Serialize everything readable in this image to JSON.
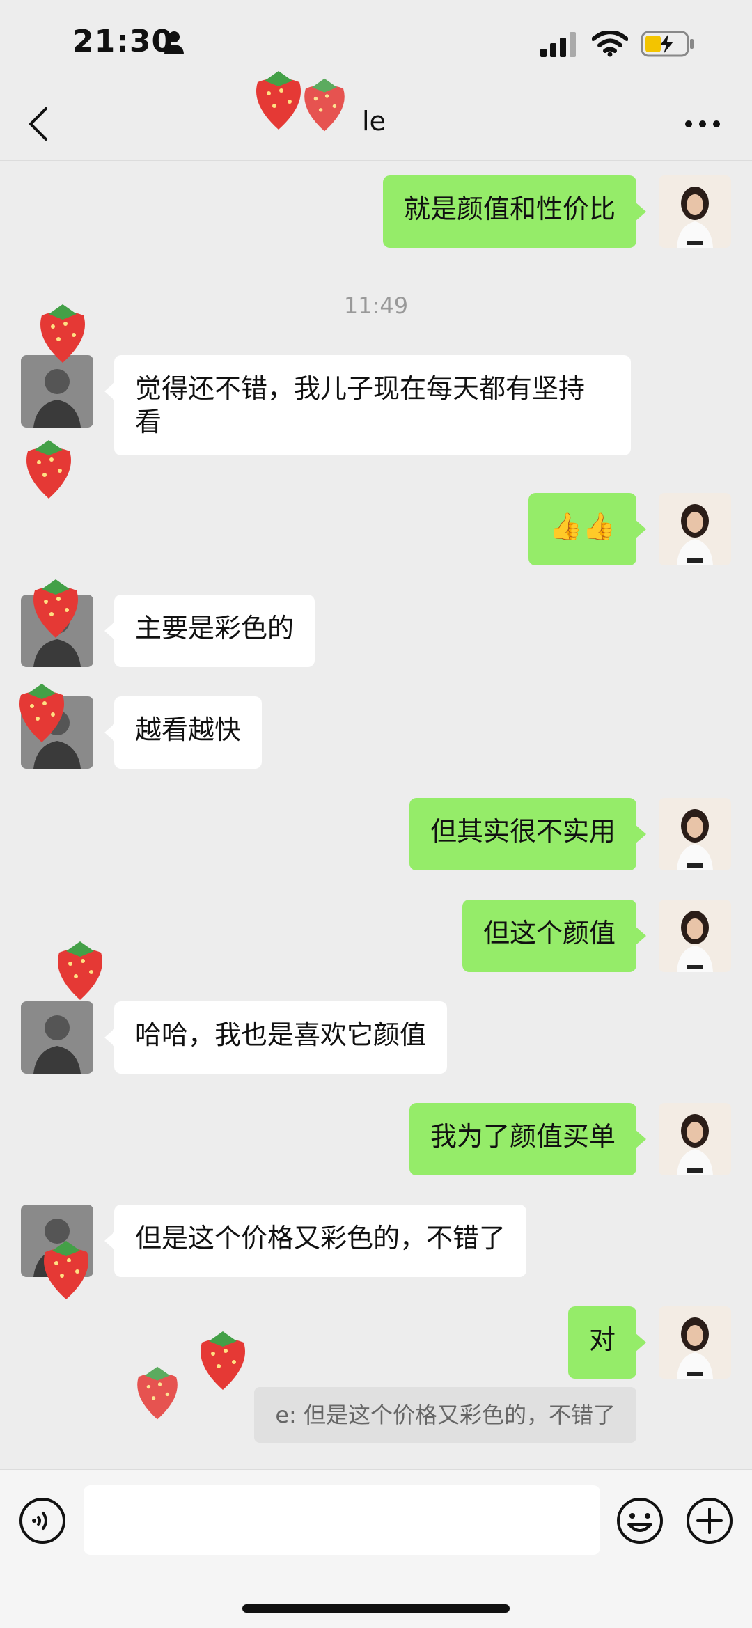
{
  "status_bar": {
    "time": "21:30"
  },
  "nav": {
    "title": "le"
  },
  "timestamp": "11:49",
  "messages": [
    {
      "side": "right",
      "text": "就是颜值和性价比"
    },
    {
      "side": "left",
      "text": "觉得还不错，我儿子现在每天都有坚持看"
    },
    {
      "side": "right",
      "text": "👍👍"
    },
    {
      "side": "left",
      "text": "主要是彩色的"
    },
    {
      "side": "left",
      "text": "越看越快"
    },
    {
      "side": "right",
      "text": "但其实很不实用"
    },
    {
      "side": "right",
      "text": "但这个颜值"
    },
    {
      "side": "left",
      "text": "哈哈，我也是喜欢它颜值"
    },
    {
      "side": "right",
      "text": "我为了颜值买单"
    },
    {
      "side": "left",
      "text": "但是这个价格又彩色的，不错了"
    },
    {
      "side": "right",
      "text": "对"
    }
  ],
  "quote": {
    "text": "e: 但是这个价格又彩色的，不错了"
  },
  "input": {
    "placeholder": ""
  },
  "colors": {
    "self_bubble": "#95ec69",
    "other_bubble": "#ffffff",
    "background": "#ededed"
  },
  "icons": [
    "person-icon",
    "signal-icon",
    "wifi-icon",
    "battery-charging-icon",
    "back-icon",
    "more-icon",
    "voice-icon",
    "emoji-icon",
    "plus-icon",
    "strawberry-sticker"
  ]
}
